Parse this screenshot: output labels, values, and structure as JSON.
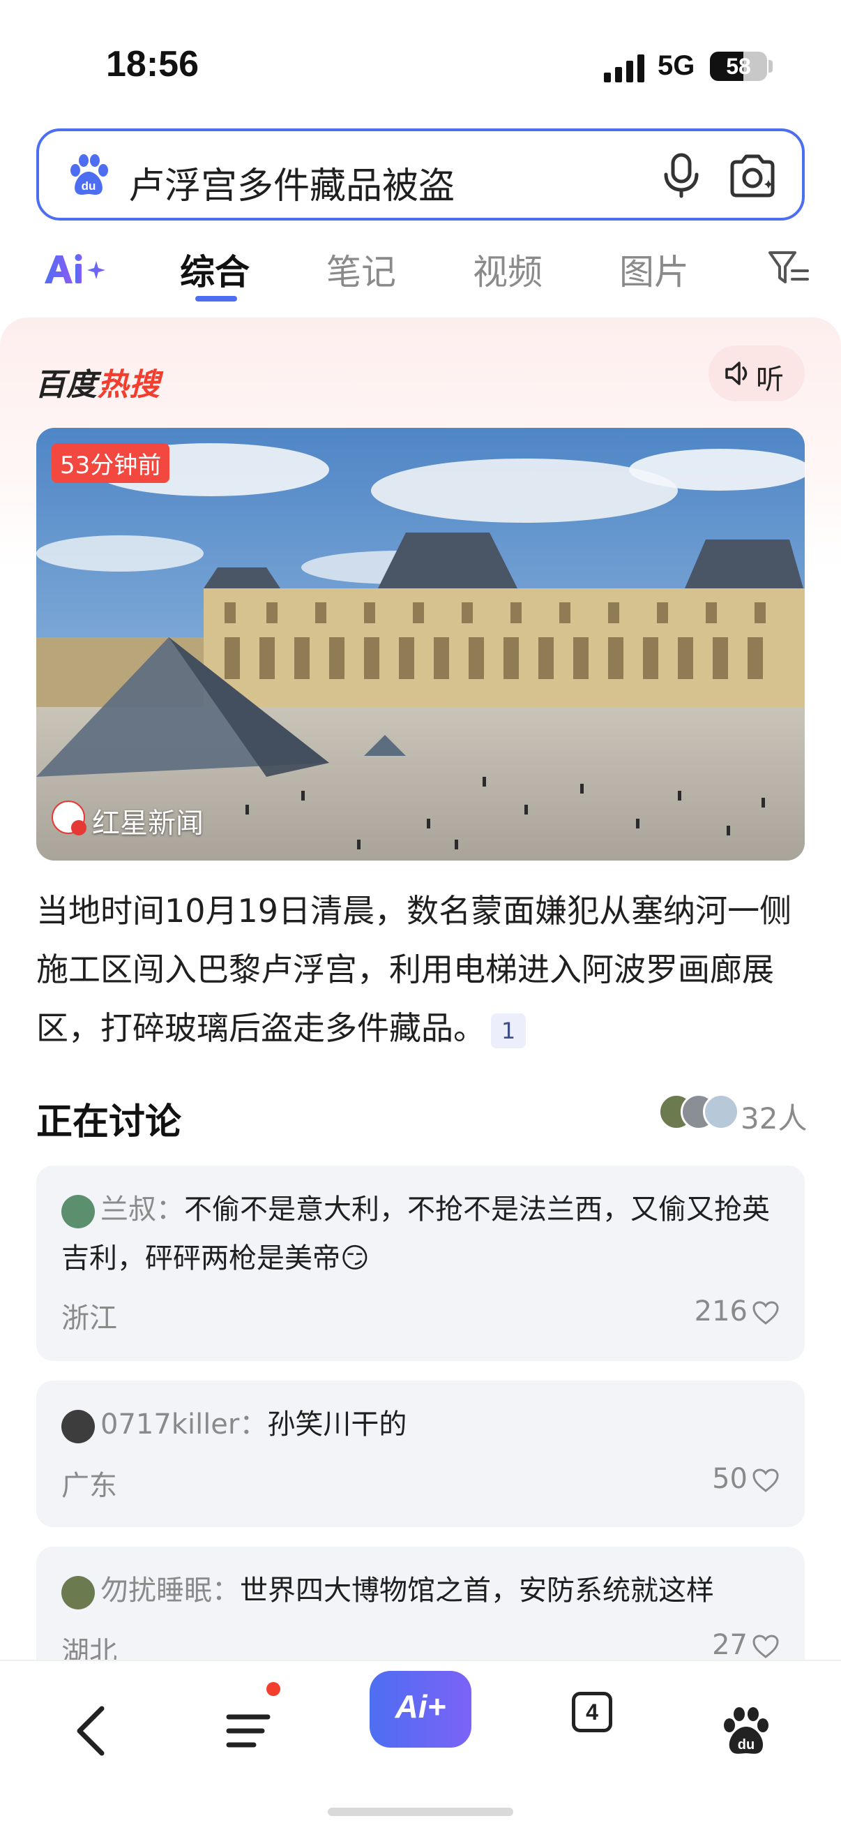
{
  "status_bar": {
    "time": "18:56",
    "network": "5G",
    "battery": "58",
    "battery_level": 0.58
  },
  "search": {
    "query": "卢浮宫多件藏品被盗",
    "logo": "baidu-paw-icon"
  },
  "tabs": [
    {
      "label": "综合",
      "active": true
    },
    {
      "label": "笔记",
      "active": false
    },
    {
      "label": "视频",
      "active": false
    },
    {
      "label": "图片",
      "active": false
    }
  ],
  "hot": {
    "logo_prefix": "百度",
    "logo_suffix": "热搜",
    "listen_label": "听",
    "time_badge": "53分钟前",
    "source": "红星新闻",
    "summary": "当地时间10月19日清晨，数名蒙面嫌犯从塞纳河一侧施工区闯入巴黎卢浮宫，利用电梯进入阿波罗画廊展区，打碎玻璃后盗走多件藏品。",
    "cite": "1"
  },
  "discussion": {
    "title": "正在讨论",
    "people": "32人",
    "comments": [
      {
        "user": "兰叔：",
        "text": "不偷不是意大利，不抢不是法兰西，又偷又抢英吉利，砰砰两枪是美帝",
        "emoji": "😏",
        "region": "浙江",
        "likes": "216"
      },
      {
        "user": "0717killer：",
        "text": "孙笑川干的",
        "emoji": "",
        "region": "广东",
        "likes": "50"
      },
      {
        "user": "勿扰睡眠：",
        "text": "世界四大博物馆之首，安防系统就这样",
        "emoji": "",
        "region": "湖北",
        "likes": "27"
      }
    ]
  },
  "bottom_nav": {
    "ai_label": "Ai+",
    "tab_count": "4"
  },
  "colors": {
    "accent": "#4e6ef2",
    "hot_red": "#f33d2e",
    "comment_bg": "#f3f4f8"
  }
}
